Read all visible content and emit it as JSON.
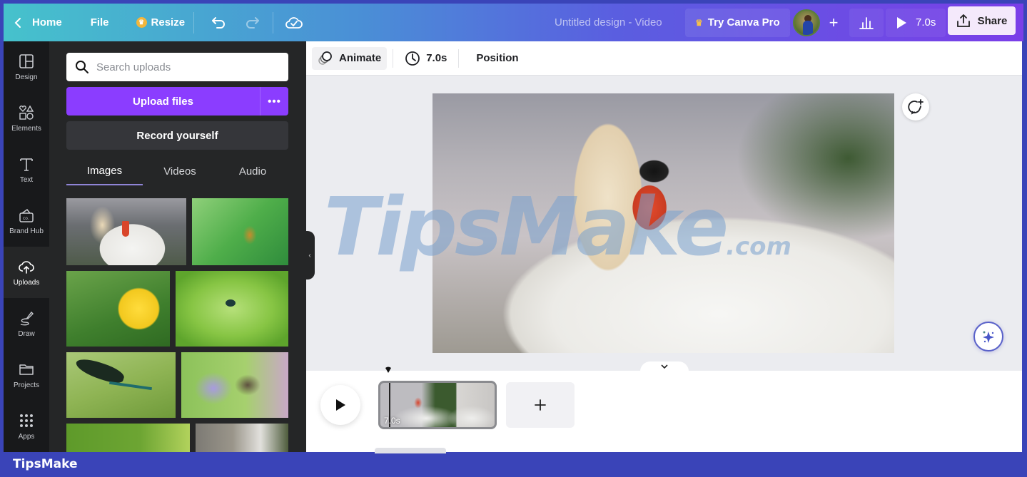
{
  "topbar": {
    "home_label": "Home",
    "file_label": "File",
    "resize_label": "Resize",
    "document_title": "Untitled design - Video",
    "try_pro_label": "Try Canva Pro",
    "play_duration": "7.0s",
    "share_label": "Share",
    "icons": {
      "back": "chevron-left-icon",
      "resize_badge": "crown-icon",
      "undo": "undo-icon",
      "redo": "redo-icon",
      "save_status": "cloud-check-icon",
      "add_collaborator": "plus-icon",
      "insights": "bar-chart-icon",
      "play": "play-icon",
      "share": "upload-share-icon"
    }
  },
  "sidebar": {
    "items": [
      {
        "label": "Design",
        "icon": "layout-icon"
      },
      {
        "label": "Elements",
        "icon": "shapes-icon"
      },
      {
        "label": "Text",
        "icon": "text-icon"
      },
      {
        "label": "Brand Hub",
        "icon": "brand-kit-icon"
      },
      {
        "label": "Uploads",
        "icon": "cloud-upload-icon",
        "active": true
      },
      {
        "label": "Draw",
        "icon": "pen-icon"
      },
      {
        "label": "Projects",
        "icon": "folder-icon"
      },
      {
        "label": "Apps",
        "icon": "grid-icon"
      }
    ]
  },
  "uploads_panel": {
    "search_placeholder": "Search uploads",
    "upload_button": "Upload files",
    "more_options": "•••",
    "record_button": "Record yourself",
    "tabs": [
      {
        "label": "Images",
        "active": true
      },
      {
        "label": "Videos",
        "active": false
      },
      {
        "label": "Audio",
        "active": false
      }
    ],
    "images": [
      {
        "subject": "swan"
      },
      {
        "subject": "insect on leaf"
      },
      {
        "subject": "dandelion with hoverfly"
      },
      {
        "subject": "damselfly on grass"
      },
      {
        "subject": "dragonfly"
      },
      {
        "subject": "bee on purple flower"
      },
      {
        "subject": "green leaf"
      },
      {
        "subject": "city buildings"
      }
    ]
  },
  "context_toolbar": {
    "animate_label": "Animate",
    "duration_label": "7.0s",
    "position_label": "Position"
  },
  "canvas": {
    "subject": "swan",
    "watermark_main": "TipsMake",
    "watermark_suffix": ".com"
  },
  "timeline": {
    "clip_duration": "7.0s"
  },
  "footer": {
    "brand": "TipsMake"
  },
  "colors": {
    "accent_purple": "#8b3dff",
    "panel_bg": "#252627",
    "rail_bg": "#18191b",
    "frame_blue": "#3a44b8"
  }
}
